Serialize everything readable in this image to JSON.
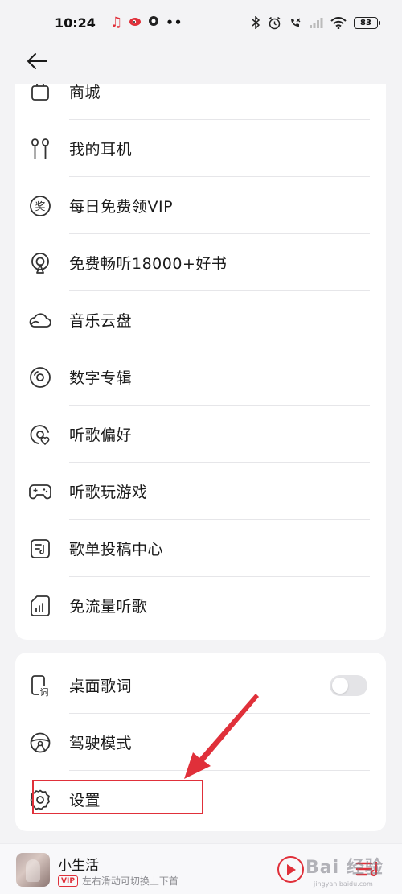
{
  "status_bar": {
    "time": "10:24",
    "battery": "83"
  },
  "header": {
    "back_icon": "arrow-left-icon"
  },
  "menu_group_1": [
    {
      "label": "商城",
      "icon": "store-icon"
    },
    {
      "label": "我的耳机",
      "icon": "earphones-icon"
    },
    {
      "label": "每日免费领VIP",
      "icon": "award-icon"
    },
    {
      "label": "免费畅听18000+好书",
      "icon": "audiobook-icon"
    },
    {
      "label": "音乐云盘",
      "icon": "cloud-icon"
    },
    {
      "label": "数字专辑",
      "icon": "disc-icon"
    },
    {
      "label": "听歌偏好",
      "icon": "preference-icon"
    },
    {
      "label": "听歌玩游戏",
      "icon": "gamepad-icon"
    },
    {
      "label": "歌单投稿中心",
      "icon": "playlist-submit-icon"
    },
    {
      "label": "免流量听歌",
      "icon": "data-free-icon"
    }
  ],
  "menu_group_2": [
    {
      "label": "桌面歌词",
      "icon": "desktop-lyrics-icon",
      "toggle": false
    },
    {
      "label": "驾驶模式",
      "icon": "steering-wheel-icon"
    },
    {
      "label": "设置",
      "icon": "gear-icon"
    }
  ],
  "player": {
    "title": "小生活",
    "vip_badge": "VIP",
    "hint": "左右滑动可切换上下首"
  },
  "watermark": {
    "brand": "Bai 经验",
    "url": "jingyan.baidu.com"
  },
  "colors": {
    "accent": "#e0303a",
    "background": "#f3f3f5",
    "card": "#ffffff"
  }
}
